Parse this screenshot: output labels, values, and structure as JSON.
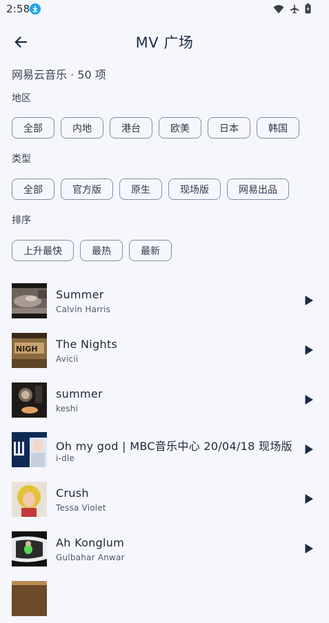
{
  "status_bar": {
    "time": "2:58",
    "icons": [
      "download-icon",
      "wifi-icon",
      "airplane-icon",
      "battery-icon"
    ]
  },
  "header": {
    "title": "MV 广场",
    "back_icon": "arrow-left-icon"
  },
  "summary": "网易云音乐 · 50 项",
  "filters": {
    "region": {
      "label": "地区",
      "options": [
        "全部",
        "内地",
        "港台",
        "欧美",
        "日本",
        "韩国"
      ]
    },
    "type": {
      "label": "类型",
      "options": [
        "全部",
        "官方版",
        "原生",
        "现场版",
        "网易出品"
      ]
    },
    "order": {
      "label": "排序",
      "options": [
        "上升最快",
        "最热",
        "最新"
      ]
    }
  },
  "mv_list": [
    {
      "title": "Summer",
      "artist": "Calvin Harris"
    },
    {
      "title": "The Nights",
      "artist": "Avicii"
    },
    {
      "title": "summer",
      "artist": "keshi"
    },
    {
      "title": "Oh my god | MBC音乐中心 20/04/18 现场版",
      "artist": "i-dle"
    },
    {
      "title": "Crush",
      "artist": "Tessa Violet"
    },
    {
      "title": "Ah Konglum",
      "artist": "Gulbahar Anwar"
    }
  ],
  "colors": {
    "background": "#f6f7fd",
    "chip_border": "#7f8ea6",
    "accent": "#1aa3ec",
    "play": "#1c2c44"
  }
}
